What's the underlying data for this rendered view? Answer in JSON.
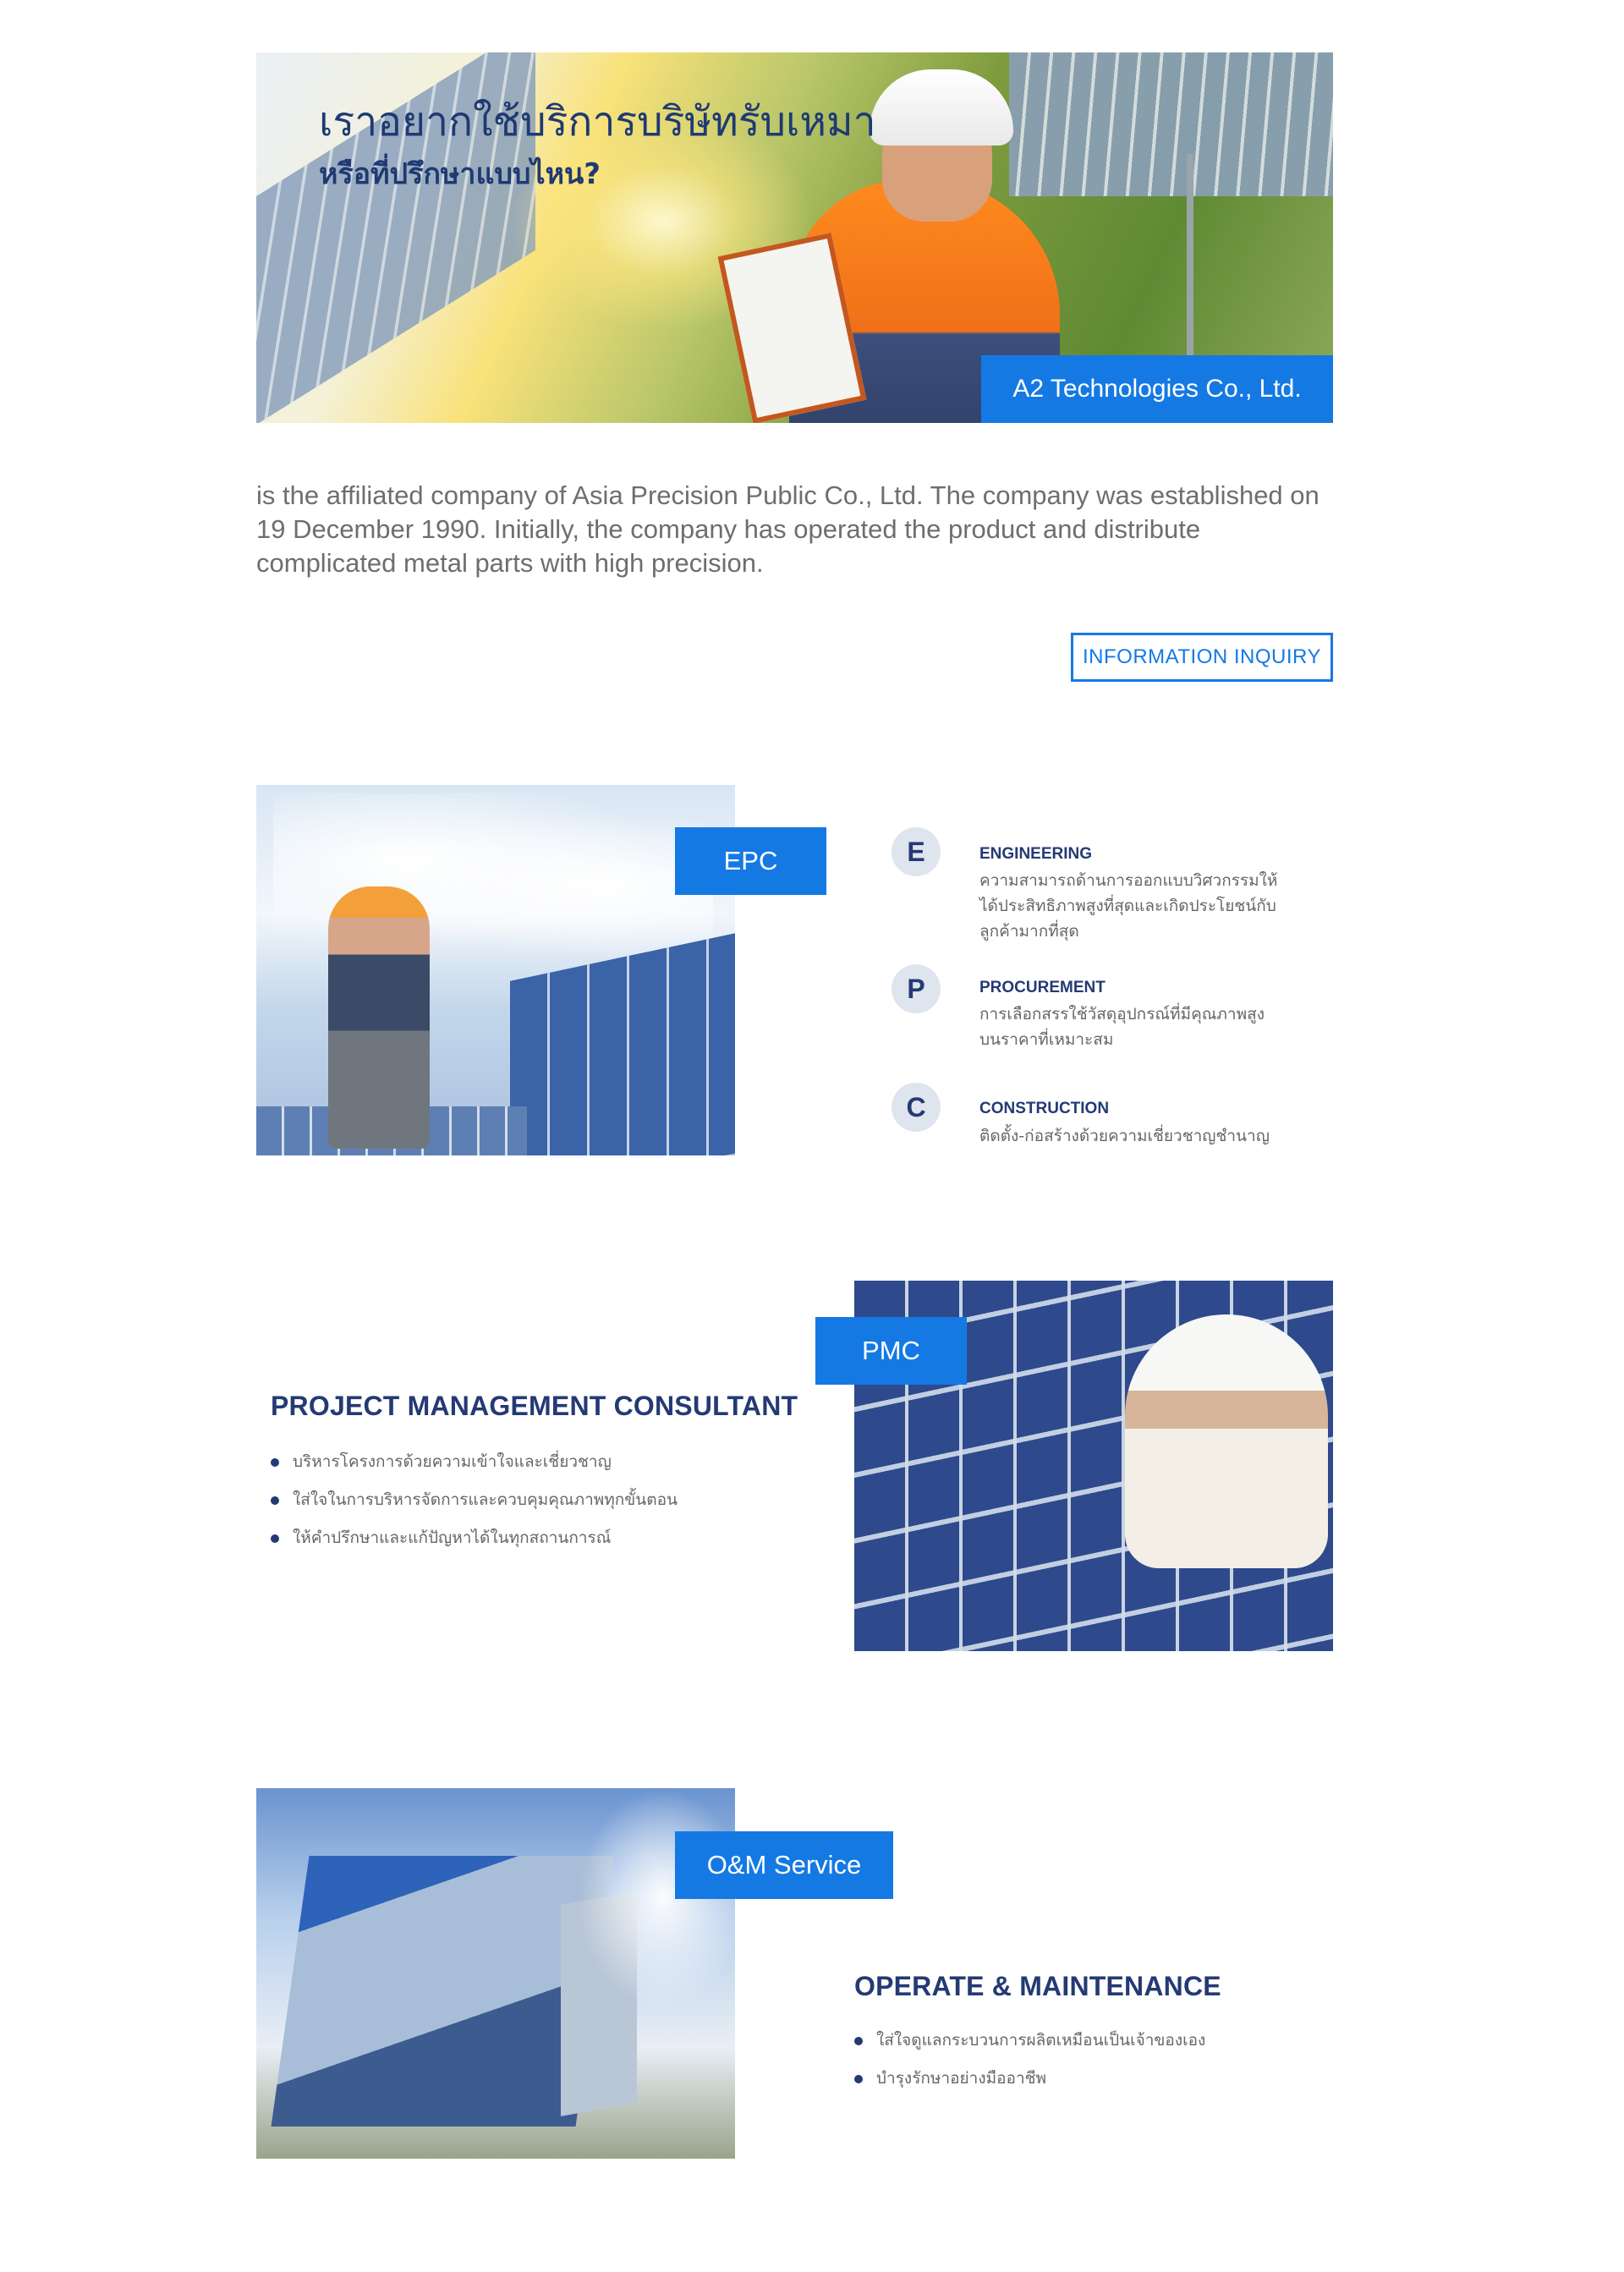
{
  "hero": {
    "title": "เราอยากใช้บริการบริษัทรับเหมา",
    "subtitle": "หรือที่ปรึกษาแบบไหน?",
    "company_badge": "A2 Technologies Co., Ltd."
  },
  "intro": {
    "text": "is the affiliated company of Asia Precision Public Co., Ltd. The company was established on 19 December 1990. Initially, the company has operated the product and distribute complicated metal parts with high precision.",
    "button_label": "INFORMATION INQUIRY"
  },
  "epc": {
    "tag": "EPC",
    "items": [
      {
        "letter": "E",
        "title": "ENGINEERING",
        "desc": "ความสามารถด้านการออกแบบวิศวกรรมให้ได้ประสิทธิภาพสูงที่สุดและเกิดประโยชน์กับลูกค้ามากที่สุด"
      },
      {
        "letter": "P",
        "title": "PROCUREMENT",
        "desc": "การเลือกสรรใช้วัสดุอุปกรณ์ที่มีคุณภาพสูง บนราคาที่เหมาะสม"
      },
      {
        "letter": "C",
        "title": "CONSTRUCTION",
        "desc": "ติดตั้ง-ก่อสร้างด้วยความเชี่ยวชาญชำนาญ"
      }
    ]
  },
  "pmc": {
    "tag": "PMC",
    "heading": "PROJECT MANAGEMENT CONSULTANT",
    "bullets": [
      "บริหารโครงการด้วยความเข้าใจและเชี่ยวชาญ",
      "ใส่ใจในการบริหารจัดการและควบคุมคุณภาพทุกขั้นตอน",
      "ให้คำปรึกษาและแก้ปัญหาได้ในทุกสถานการณ์"
    ]
  },
  "om": {
    "tag": "O&M Service",
    "heading": "OPERATE & MAINTENANCE",
    "bullets": [
      "ใส่ใจดูแลกระบวนการผลิตเหมือนเป็นเจ้าของเอง",
      "บำรุงรักษาอย่างมืออาชีพ"
    ]
  },
  "colors": {
    "accent": "#1579e4",
    "heading": "#243a74",
    "body_text": "#6e6e6e",
    "circle_bg": "#dfe5ee"
  }
}
